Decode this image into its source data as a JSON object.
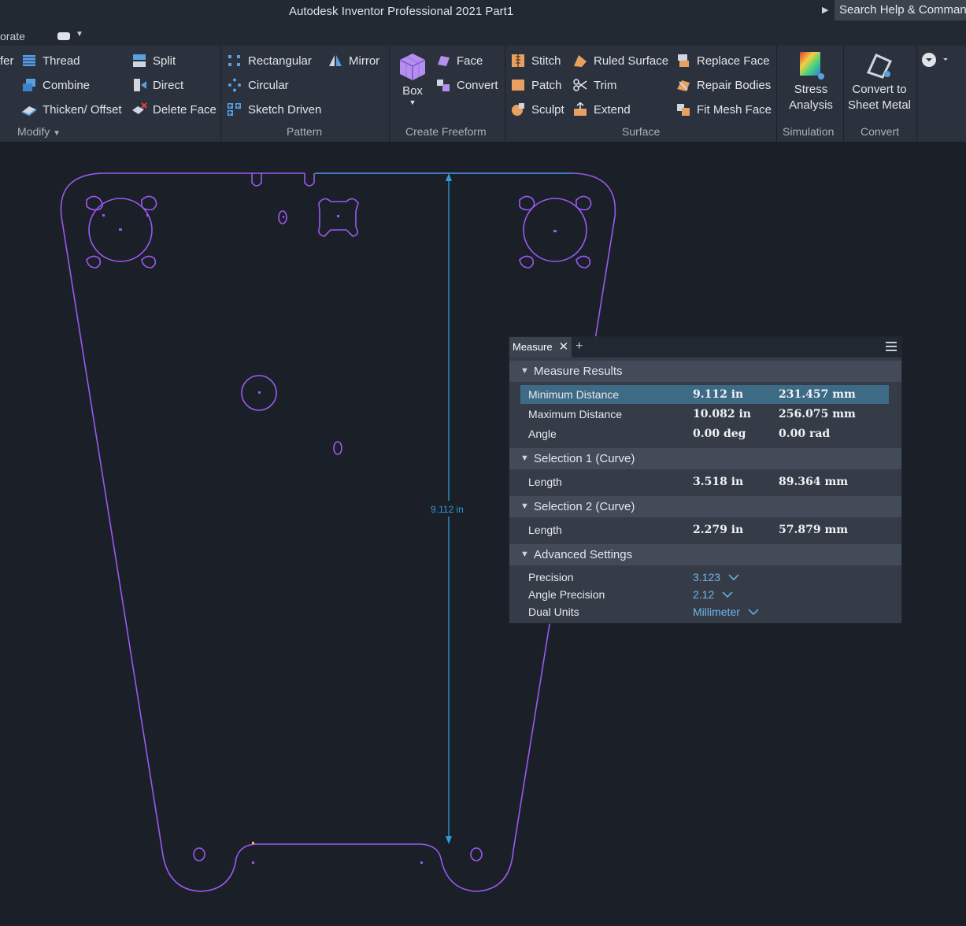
{
  "window": {
    "title": "Autodesk Inventor Professional 2021    Part1"
  },
  "search": {
    "placeholder": "Search Help & Commands..."
  },
  "tabs": {
    "partial_tab": "orate"
  },
  "ribbon": {
    "modify": {
      "partial_item": "fer",
      "thread": "Thread",
      "combine": "Combine",
      "thicken": "Thicken/ Offset",
      "split": "Split",
      "direct": "Direct",
      "delete_face": "Delete Face",
      "label": "Modify"
    },
    "pattern": {
      "rectangular": "Rectangular",
      "circular": "Circular",
      "sketch_driven": "Sketch Driven",
      "mirror": "Mirror",
      "label": "Pattern"
    },
    "create_freeform": {
      "box": "Box",
      "face": "Face",
      "convert": "Convert",
      "label": "Create Freeform"
    },
    "surface": {
      "stitch": "Stitch",
      "patch": "Patch",
      "sculpt": "Sculpt",
      "ruled_surface": "Ruled Surface",
      "trim": "Trim",
      "extend": "Extend",
      "replace_face": "Replace Face",
      "repair_bodies": "Repair Bodies",
      "fit_mesh_face": "Fit Mesh Face",
      "label": "Surface"
    },
    "simulation": {
      "stress_line1": "Stress",
      "stress_line2": "Analysis",
      "label": "Simulation"
    },
    "convert": {
      "line1": "Convert to",
      "line2": "Sheet Metal",
      "label": "Convert"
    }
  },
  "viewport": {
    "dimension_label": "9.112 in"
  },
  "measure": {
    "tab": "Measure",
    "sections": {
      "results": "Measure Results",
      "sel1": "Selection 1 (Curve)",
      "sel2": "Selection 2 (Curve)",
      "advanced": "Advanced Settings"
    },
    "results": [
      {
        "label": "Minimum Distance",
        "in": "9.112 in",
        "mm": "231.457 mm"
      },
      {
        "label": "Maximum Distance",
        "in": "10.082 in",
        "mm": "256.075 mm"
      },
      {
        "label": "Angle",
        "in": "0.00 deg",
        "mm": "0.00 rad"
      }
    ],
    "sel1": {
      "label": "Length",
      "in": "3.518 in",
      "mm": "89.364 mm"
    },
    "sel2": {
      "label": "Length",
      "in": "2.279 in",
      "mm": "57.879 mm"
    },
    "advanced": {
      "precision_label": "Precision",
      "precision_value": "3.123",
      "angle_precision_label": "Angle Precision",
      "angle_precision_value": "2.12",
      "dual_units_label": "Dual Units",
      "dual_units_value": "Millimeter"
    }
  },
  "colors": {
    "sketch": "#9b59f0",
    "dimension": "#2d9cdb",
    "highlight": "#3d6a85"
  }
}
